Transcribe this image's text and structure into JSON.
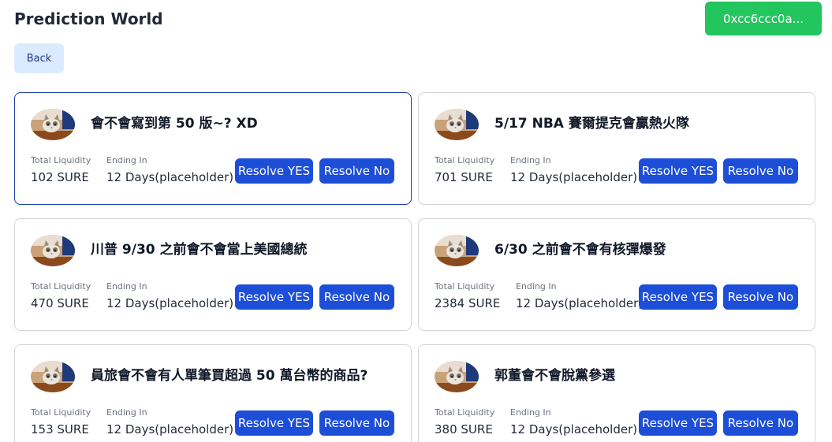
{
  "header": {
    "title": "Prediction World",
    "wallet_label": "0xcc6ccc0a...",
    "back_label": "Back"
  },
  "colors": {
    "wallet": "#22c55e",
    "back_bg": "#dbeafe",
    "resolve_bg": "#1d4ed8",
    "active_border": "#1e40af"
  },
  "labels": {
    "liquidity": "Total Liquidity",
    "ending": "Ending In",
    "resolve_yes": "Resolve YES",
    "resolve_no": "Resolve No"
  },
  "markets": [
    {
      "question": "會不會寫到第 50 版~? XD",
      "liquidity": "102 SURE",
      "ending": "12 Days(placeholder)",
      "active": true
    },
    {
      "question": "5/17 NBA 賽爾提克會贏熱火隊",
      "liquidity": "701 SURE",
      "ending": "12 Days(placeholder)",
      "active": false
    },
    {
      "question": "川普 9/30 之前會不會當上美國總統",
      "liquidity": "470 SURE",
      "ending": "12 Days(placeholder)",
      "active": false
    },
    {
      "question": "6/30 之前會不會有核彈爆發",
      "liquidity": "2384 SURE",
      "ending": "12 Days(placeholder)",
      "active": false
    },
    {
      "question": "員旅會不會有人單筆買超過 50 萬台幣的商品?",
      "liquidity": "153 SURE",
      "ending": "12 Days(placeholder)",
      "active": false
    },
    {
      "question": "郭董會不會脫黨參選",
      "liquidity": "380 SURE",
      "ending": "12 Days(placeholder)",
      "active": false
    }
  ]
}
